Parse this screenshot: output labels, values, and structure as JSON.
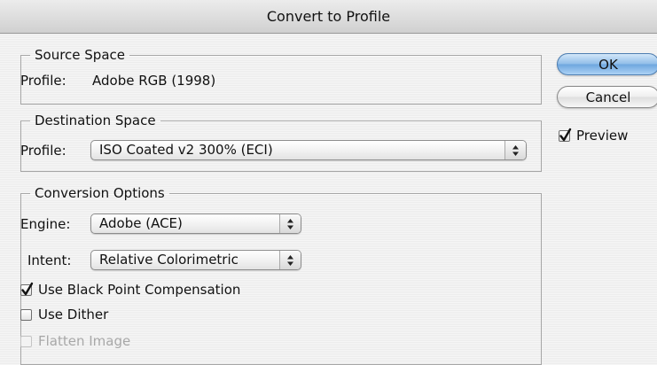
{
  "window": {
    "title": "Convert to Profile"
  },
  "source": {
    "legend": "Source Space",
    "profile_label": "Profile:",
    "profile_value": "Adobe RGB (1998)"
  },
  "destination": {
    "legend": "Destination Space",
    "profile_label": "Profile:",
    "profile_value": "ISO Coated v2 300% (ECI)"
  },
  "conversion": {
    "legend": "Conversion Options",
    "engine_label": "Engine:",
    "engine_value": "Adobe (ACE)",
    "intent_label": "Intent:",
    "intent_value": "Relative Colorimetric",
    "black_point": {
      "label": "Use Black Point Compensation",
      "checked": true
    },
    "dither": {
      "label": "Use Dither",
      "checked": false
    },
    "flatten": {
      "label": "Flatten Image",
      "checked": false,
      "enabled": false
    }
  },
  "buttons": {
    "ok": "OK",
    "cancel": "Cancel"
  },
  "preview": {
    "label": "Preview",
    "checked": true
  },
  "colors": {
    "default_button": "#8fbce8",
    "disabled_text": "#a8a8a8"
  }
}
